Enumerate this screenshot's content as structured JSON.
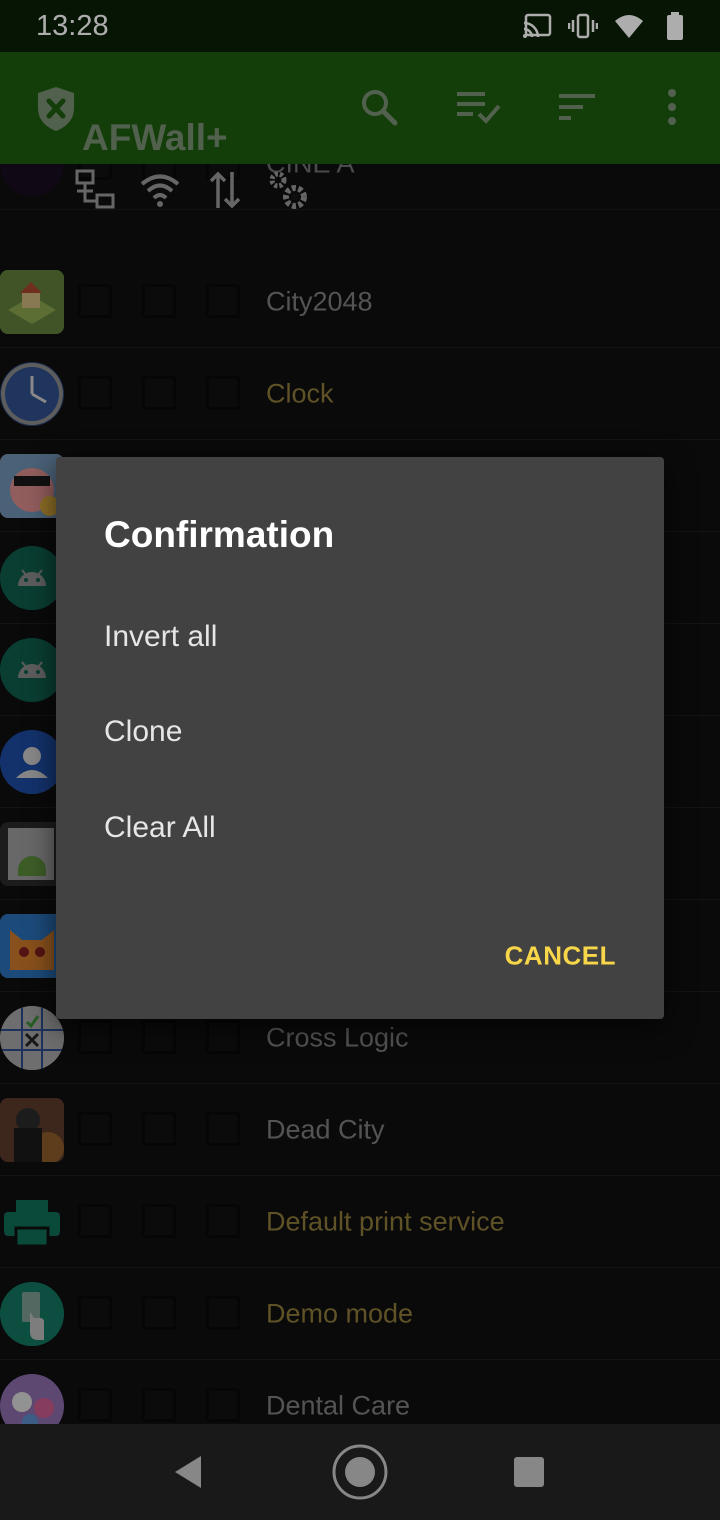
{
  "status_bar": {
    "time": "13:28",
    "icons": [
      "cast-icon",
      "vibrate-icon",
      "wifi-icon",
      "battery-icon"
    ]
  },
  "app_bar": {
    "title": "AFWall+",
    "logo_icon": "shield-x-icon",
    "actions": [
      "search-icon",
      "select-all-icon",
      "sort-icon",
      "more-vert-icon"
    ]
  },
  "column_headers": [
    "lan-icon",
    "wifi-icon",
    "mobile-data-icon",
    "settings-icon"
  ],
  "apps": [
    {
      "name": "CINE A",
      "system": false
    },
    {
      "name": "City2048",
      "system": false
    },
    {
      "name": "Clock",
      "system": true
    },
    {
      "name": "",
      "system": false
    },
    {
      "name": "",
      "system": false
    },
    {
      "name": "",
      "system": false
    },
    {
      "name": "",
      "system": false
    },
    {
      "name": "",
      "system": false
    },
    {
      "name": "",
      "system": false
    },
    {
      "name": "Cross Logic",
      "system": false
    },
    {
      "name": "Dead City",
      "system": false
    },
    {
      "name": "Default print service",
      "system": true
    },
    {
      "name": "Demo mode",
      "system": true
    },
    {
      "name": "Dental Care",
      "system": false
    }
  ],
  "dialog": {
    "title": "Confirmation",
    "items": [
      "Invert all",
      "Clone",
      "Clear All"
    ],
    "cancel_label": "CANCEL"
  },
  "colors": {
    "toolbar": "#1d5c10",
    "status_bar": "#0a1f06",
    "system_app_text": "#8c7a3a",
    "user_app_text": "#7c7c7c",
    "dialog_bg": "#424242",
    "accent": "#f7d64a"
  },
  "nav_bar": [
    "back-icon",
    "home-icon",
    "recents-icon"
  ]
}
